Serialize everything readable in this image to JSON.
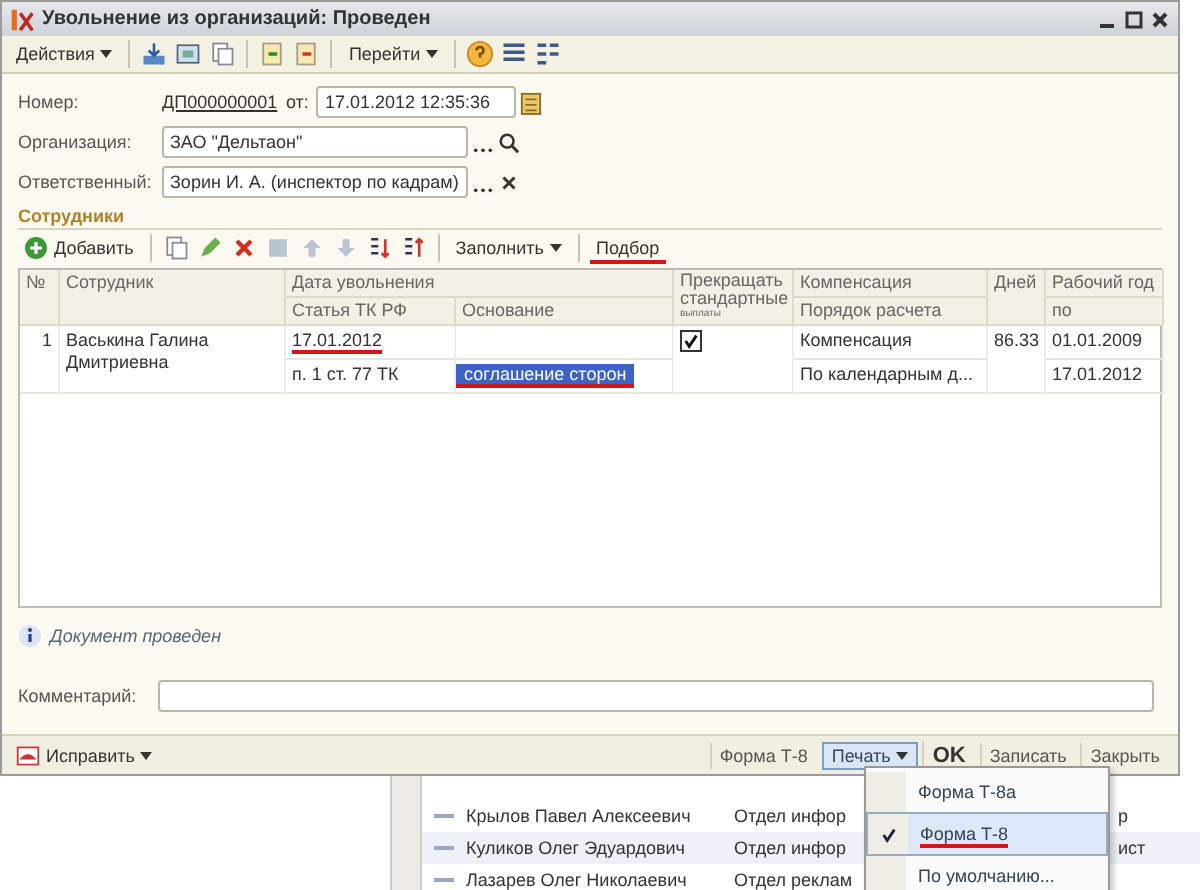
{
  "window": {
    "title": "Увольнение из организаций: Проведен"
  },
  "toolbar": {
    "menus": [
      "Действия",
      "Перейти"
    ]
  },
  "header": {
    "number_label": "Номер:",
    "number": "ДП000000001",
    "date_label": "от:",
    "date": "17.01.2012 12:35:36",
    "organization_label": "Организация:",
    "organization": "ЗАО \"Дельтаон\"",
    "responsible_label": "Ответственный:",
    "responsible": "Зорин И. А. (инспектор по кадрам)"
  },
  "section_title": "Сотрудники",
  "table_toolbar": {
    "add": "Добавить",
    "fill": "Заполнить",
    "pick": {
      "label": "Подбор",
      "underlined": true
    }
  },
  "table": {
    "columns": {
      "number": "№",
      "employee": "Сотрудник",
      "dismissal_date": "Дата увольнения",
      "article": "Статья ТК РФ",
      "reason": "Основание",
      "stop_payments": "Прекращать стандартные",
      "stop_payments_note": "выплаты",
      "compensation": "Компенсация",
      "calc_order": "Порядок расчета",
      "days": "Дней",
      "work_year": "Рабочий год",
      "work_year_to": "по"
    },
    "rows": [
      {
        "number": "1",
        "employee": "Васькина Галина Дмитриевна",
        "date": "17.01.2012",
        "date_underlined": true,
        "article": "п. 1 ст. 77 ТК",
        "reason": "соглашение сторон",
        "reason_selected": true,
        "reason_underlined": true,
        "stop_payments": true,
        "compensation": "Компенсация",
        "calc_order": "По календарным д...",
        "days": "86.33",
        "work_year_from": "01.01.2009",
        "work_year_to": "17.01.2012"
      }
    ]
  },
  "status": "Документ проведен",
  "comment_label": "Комментарий:",
  "bottom_bar": {
    "fix": "Исправить",
    "form": "Форма Т-8",
    "buttons": [
      {
        "label": "Печать",
        "kind": "menu",
        "pressed": true
      },
      {
        "label": "OK",
        "kind": "default",
        "pressed": false
      },
      {
        "label": "Записать",
        "kind": "plain",
        "pressed": false
      },
      {
        "label": "Закрыть",
        "kind": "plain",
        "pressed": false
      }
    ]
  },
  "print_menu": {
    "items": [
      {
        "label": "Форма Т-8а",
        "checked": false,
        "selected": false,
        "underlined": false
      },
      {
        "label": "Форма Т-8",
        "checked": true,
        "selected": true,
        "underlined": true
      },
      {
        "label": "По умолчанию...",
        "checked": false,
        "selected": false,
        "underlined": false
      }
    ]
  },
  "background_list": {
    "rows": [
      {
        "name": "Крылов Павел Алексеевич",
        "department": "Отдел инфор",
        "column_3": "р"
      },
      {
        "name": "Куликов Олег Эдуардович",
        "department": "Отдел инфор",
        "column_3": "ист"
      },
      {
        "name": "Лазарев Олег Николаевич",
        "department": "Отдел реклам"
      }
    ]
  }
}
